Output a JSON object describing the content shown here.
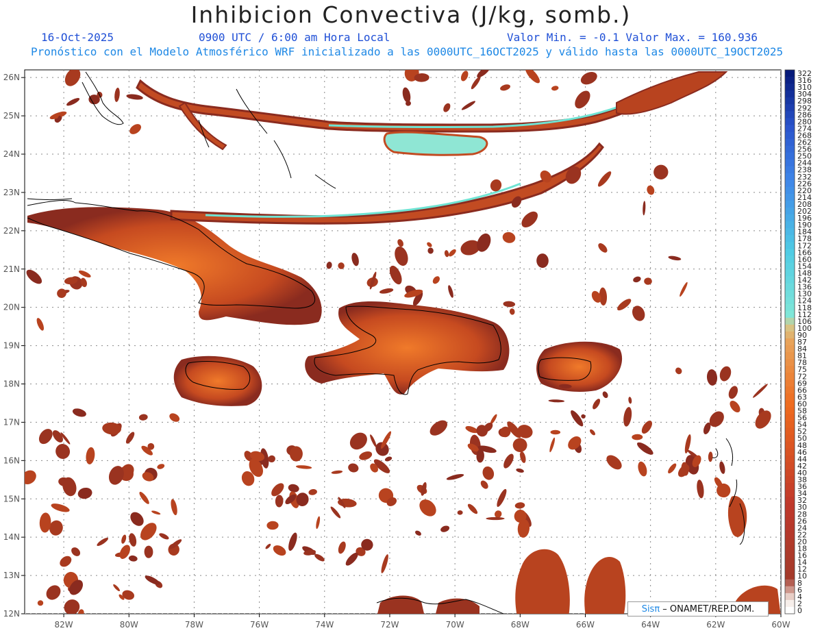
{
  "header": {
    "title": "Inhibicion Convectiva (J/kg, somb.)",
    "date": "16-Oct-2025",
    "time": "0900 UTC / 6:00 am Hora Local",
    "value_range": "Valor Min. = -0.1  Valor Max. = 160.936",
    "forecast_note": "Pronóstico con el Modelo Atmosférico WRF inicializado a las 0000UTC_16OCT2025 y válido hasta las  0000UTC_19OCT2025"
  },
  "map": {
    "lat_labels": [
      "26N",
      "25N",
      "24N",
      "23N",
      "22N",
      "21N",
      "20N",
      "19N",
      "18N",
      "17N",
      "16N",
      "15N",
      "14N",
      "13N",
      "12N"
    ],
    "lon_labels": [
      "82W",
      "80W",
      "78W",
      "76W",
      "74W",
      "72W",
      "70W",
      "68W",
      "66W",
      "64W",
      "62W",
      "60W"
    ],
    "lon_range": [
      -83.2,
      -60
    ],
    "lat_range": [
      12,
      26.2
    ],
    "colors": {
      "dark": "#8a2b1f",
      "mid": "#c04a22",
      "hot": "#e86a1e",
      "cyan": "#66e0d0",
      "coast": "#000000"
    }
  },
  "colorbar": {
    "labels": [
      "322",
      "316",
      "310",
      "304",
      "298",
      "292",
      "286",
      "280",
      "274",
      "268",
      "262",
      "256",
      "250",
      "244",
      "238",
      "232",
      "226",
      "220",
      "214",
      "208",
      "202",
      "196",
      "190",
      "184",
      "178",
      "172",
      "166",
      "160",
      "154",
      "148",
      "142",
      "136",
      "130",
      "124",
      "118",
      "112",
      "106",
      "100",
      "90",
      "87",
      "84",
      "81",
      "78",
      "75",
      "72",
      "69",
      "66",
      "63",
      "60",
      "58",
      "56",
      "54",
      "52",
      "50",
      "48",
      "46",
      "44",
      "42",
      "40",
      "38",
      "36",
      "34",
      "32",
      "30",
      "28",
      "26",
      "24",
      "22",
      "20",
      "18",
      "16",
      "14",
      "12",
      "10",
      "8",
      "6",
      "4",
      "2",
      "0"
    ]
  },
  "credit": {
    "sis": "Sisπ",
    "rest": " – ONAMET/REP.DOM."
  }
}
